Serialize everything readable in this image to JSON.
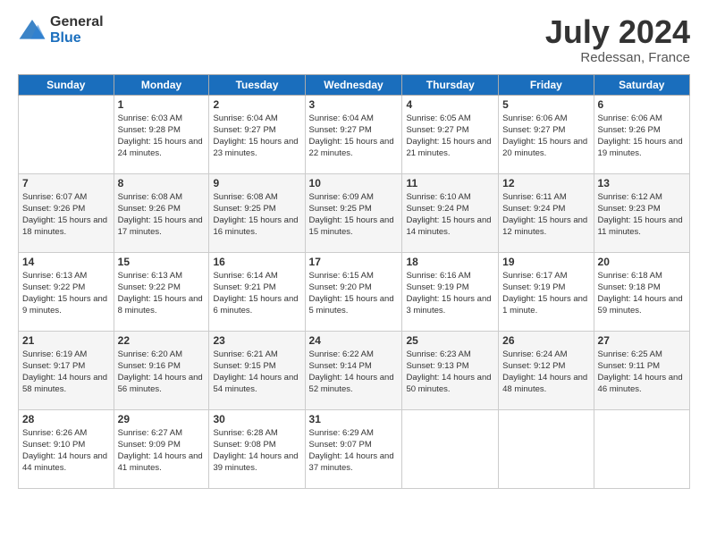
{
  "logo": {
    "general": "General",
    "blue": "Blue"
  },
  "title": "July 2024",
  "subtitle": "Redessan, France",
  "headers": [
    "Sunday",
    "Monday",
    "Tuesday",
    "Wednesday",
    "Thursday",
    "Friday",
    "Saturday"
  ],
  "weeks": [
    [
      {
        "day": "",
        "sunrise": "",
        "sunset": "",
        "daylight": ""
      },
      {
        "day": "1",
        "sunrise": "Sunrise: 6:03 AM",
        "sunset": "Sunset: 9:28 PM",
        "daylight": "Daylight: 15 hours and 24 minutes."
      },
      {
        "day": "2",
        "sunrise": "Sunrise: 6:04 AM",
        "sunset": "Sunset: 9:27 PM",
        "daylight": "Daylight: 15 hours and 23 minutes."
      },
      {
        "day": "3",
        "sunrise": "Sunrise: 6:04 AM",
        "sunset": "Sunset: 9:27 PM",
        "daylight": "Daylight: 15 hours and 22 minutes."
      },
      {
        "day": "4",
        "sunrise": "Sunrise: 6:05 AM",
        "sunset": "Sunset: 9:27 PM",
        "daylight": "Daylight: 15 hours and 21 minutes."
      },
      {
        "day": "5",
        "sunrise": "Sunrise: 6:06 AM",
        "sunset": "Sunset: 9:27 PM",
        "daylight": "Daylight: 15 hours and 20 minutes."
      },
      {
        "day": "6",
        "sunrise": "Sunrise: 6:06 AM",
        "sunset": "Sunset: 9:26 PM",
        "daylight": "Daylight: 15 hours and 19 minutes."
      }
    ],
    [
      {
        "day": "7",
        "sunrise": "Sunrise: 6:07 AM",
        "sunset": "Sunset: 9:26 PM",
        "daylight": "Daylight: 15 hours and 18 minutes."
      },
      {
        "day": "8",
        "sunrise": "Sunrise: 6:08 AM",
        "sunset": "Sunset: 9:26 PM",
        "daylight": "Daylight: 15 hours and 17 minutes."
      },
      {
        "day": "9",
        "sunrise": "Sunrise: 6:08 AM",
        "sunset": "Sunset: 9:25 PM",
        "daylight": "Daylight: 15 hours and 16 minutes."
      },
      {
        "day": "10",
        "sunrise": "Sunrise: 6:09 AM",
        "sunset": "Sunset: 9:25 PM",
        "daylight": "Daylight: 15 hours and 15 minutes."
      },
      {
        "day": "11",
        "sunrise": "Sunrise: 6:10 AM",
        "sunset": "Sunset: 9:24 PM",
        "daylight": "Daylight: 15 hours and 14 minutes."
      },
      {
        "day": "12",
        "sunrise": "Sunrise: 6:11 AM",
        "sunset": "Sunset: 9:24 PM",
        "daylight": "Daylight: 15 hours and 12 minutes."
      },
      {
        "day": "13",
        "sunrise": "Sunrise: 6:12 AM",
        "sunset": "Sunset: 9:23 PM",
        "daylight": "Daylight: 15 hours and 11 minutes."
      }
    ],
    [
      {
        "day": "14",
        "sunrise": "Sunrise: 6:13 AM",
        "sunset": "Sunset: 9:22 PM",
        "daylight": "Daylight: 15 hours and 9 minutes."
      },
      {
        "day": "15",
        "sunrise": "Sunrise: 6:13 AM",
        "sunset": "Sunset: 9:22 PM",
        "daylight": "Daylight: 15 hours and 8 minutes."
      },
      {
        "day": "16",
        "sunrise": "Sunrise: 6:14 AM",
        "sunset": "Sunset: 9:21 PM",
        "daylight": "Daylight: 15 hours and 6 minutes."
      },
      {
        "day": "17",
        "sunrise": "Sunrise: 6:15 AM",
        "sunset": "Sunset: 9:20 PM",
        "daylight": "Daylight: 15 hours and 5 minutes."
      },
      {
        "day": "18",
        "sunrise": "Sunrise: 6:16 AM",
        "sunset": "Sunset: 9:19 PM",
        "daylight": "Daylight: 15 hours and 3 minutes."
      },
      {
        "day": "19",
        "sunrise": "Sunrise: 6:17 AM",
        "sunset": "Sunset: 9:19 PM",
        "daylight": "Daylight: 15 hours and 1 minute."
      },
      {
        "day": "20",
        "sunrise": "Sunrise: 6:18 AM",
        "sunset": "Sunset: 9:18 PM",
        "daylight": "Daylight: 14 hours and 59 minutes."
      }
    ],
    [
      {
        "day": "21",
        "sunrise": "Sunrise: 6:19 AM",
        "sunset": "Sunset: 9:17 PM",
        "daylight": "Daylight: 14 hours and 58 minutes."
      },
      {
        "day": "22",
        "sunrise": "Sunrise: 6:20 AM",
        "sunset": "Sunset: 9:16 PM",
        "daylight": "Daylight: 14 hours and 56 minutes."
      },
      {
        "day": "23",
        "sunrise": "Sunrise: 6:21 AM",
        "sunset": "Sunset: 9:15 PM",
        "daylight": "Daylight: 14 hours and 54 minutes."
      },
      {
        "day": "24",
        "sunrise": "Sunrise: 6:22 AM",
        "sunset": "Sunset: 9:14 PM",
        "daylight": "Daylight: 14 hours and 52 minutes."
      },
      {
        "day": "25",
        "sunrise": "Sunrise: 6:23 AM",
        "sunset": "Sunset: 9:13 PM",
        "daylight": "Daylight: 14 hours and 50 minutes."
      },
      {
        "day": "26",
        "sunrise": "Sunrise: 6:24 AM",
        "sunset": "Sunset: 9:12 PM",
        "daylight": "Daylight: 14 hours and 48 minutes."
      },
      {
        "day": "27",
        "sunrise": "Sunrise: 6:25 AM",
        "sunset": "Sunset: 9:11 PM",
        "daylight": "Daylight: 14 hours and 46 minutes."
      }
    ],
    [
      {
        "day": "28",
        "sunrise": "Sunrise: 6:26 AM",
        "sunset": "Sunset: 9:10 PM",
        "daylight": "Daylight: 14 hours and 44 minutes."
      },
      {
        "day": "29",
        "sunrise": "Sunrise: 6:27 AM",
        "sunset": "Sunset: 9:09 PM",
        "daylight": "Daylight: 14 hours and 41 minutes."
      },
      {
        "day": "30",
        "sunrise": "Sunrise: 6:28 AM",
        "sunset": "Sunset: 9:08 PM",
        "daylight": "Daylight: 14 hours and 39 minutes."
      },
      {
        "day": "31",
        "sunrise": "Sunrise: 6:29 AM",
        "sunset": "Sunset: 9:07 PM",
        "daylight": "Daylight: 14 hours and 37 minutes."
      },
      {
        "day": "",
        "sunrise": "",
        "sunset": "",
        "daylight": ""
      },
      {
        "day": "",
        "sunrise": "",
        "sunset": "",
        "daylight": ""
      },
      {
        "day": "",
        "sunrise": "",
        "sunset": "",
        "daylight": ""
      }
    ]
  ]
}
